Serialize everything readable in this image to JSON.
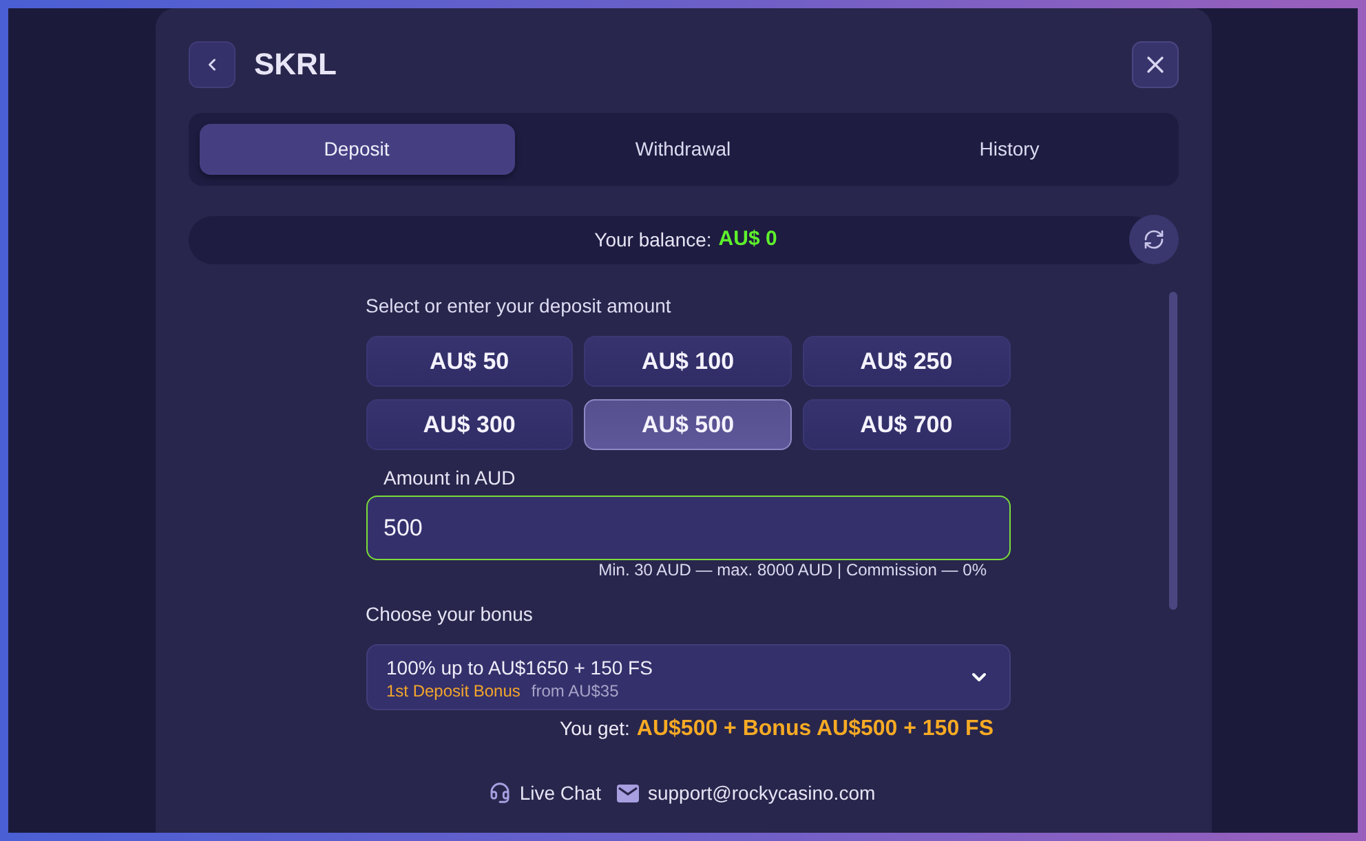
{
  "dialog": {
    "title": "SKRL"
  },
  "tabs": [
    {
      "label": "Deposit",
      "selected": true
    },
    {
      "label": "Withdrawal",
      "selected": false
    },
    {
      "label": "History",
      "selected": false
    }
  ],
  "balance": {
    "label": "Your balance:",
    "amount": "AU$ 0"
  },
  "deposit": {
    "prompt": "Select or enter your deposit amount",
    "presets": [
      {
        "label": "AU$ 50",
        "selected": false
      },
      {
        "label": "AU$ 100",
        "selected": false
      },
      {
        "label": "AU$ 250",
        "selected": false
      },
      {
        "label": "AU$ 300",
        "selected": false
      },
      {
        "label": "AU$ 500",
        "selected": true
      },
      {
        "label": "AU$ 700",
        "selected": false
      }
    ],
    "amount_field": {
      "label": "Amount in AUD",
      "value": "500",
      "hint": "Min. 30 AUD — max. 8000 AUD | Commission — 0%"
    }
  },
  "bonus": {
    "label": "Choose your bonus",
    "selected_option": {
      "title": "100% up to AU$1650 + 150 FS",
      "tag": "1st Deposit Bonus",
      "condition": "from AU$35"
    },
    "you_get_label": "You get:",
    "you_get_value": "AU$500 + Bonus AU$500 + 150 FS"
  },
  "footer": {
    "links": [
      {
        "kind": "chat",
        "label": "Live Chat"
      },
      {
        "kind": "email",
        "label": "support@rockycasino.com"
      }
    ]
  }
}
